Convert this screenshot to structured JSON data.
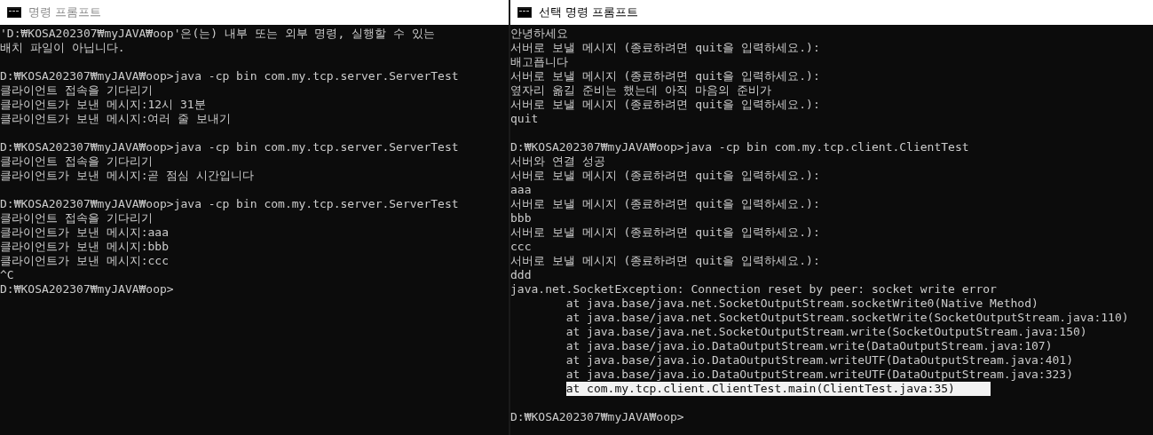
{
  "windows": [
    {
      "title": "명령 프롬프트",
      "active": false,
      "blocks": [
        [
          "'D:₩KOSA202307₩myJAVA₩oop'은(는) 내부 또는 외부 명령, 실행할 수 있는",
          "배치 파일이 아닙니다."
        ],
        [
          "D:₩KOSA202307₩myJAVA₩oop>java -cp bin com.my.tcp.server.ServerTest",
          "클라이언트 접속을 기다리기",
          "클라이언트가 보낸 메시지:12시 31분",
          "클라이언트가 보낸 메시지:여러 줄 보내기"
        ],
        [
          "D:₩KOSA202307₩myJAVA₩oop>java -cp bin com.my.tcp.server.ServerTest",
          "클라이언트 접속을 기다리기",
          "클라이언트가 보낸 메시지:곧 점심 시간입니다"
        ],
        [
          "D:₩KOSA202307₩myJAVA₩oop>java -cp bin com.my.tcp.server.ServerTest",
          "클라이언트 접속을 기다리기",
          "클라이언트가 보낸 메시지:aaa",
          "클라이언트가 보낸 메시지:bbb",
          "클라이언트가 보낸 메시지:ccc",
          "^C",
          "D:₩KOSA202307₩myJAVA₩oop>"
        ]
      ]
    },
    {
      "title": "선택 명령 프롬프트",
      "active": true,
      "blocks": [
        [
          "안녕하세요",
          "서버로 보낼 메시지 (종료하려면 quit을 입력하세요.):",
          "배고픕니다",
          "서버로 보낼 메시지 (종료하려면 quit을 입력하세요.):",
          "옆자리 옮길 준비는 했는데 아직 마음의 준비가",
          "서버로 보낼 메시지 (종료하려면 quit을 입력하세요.):",
          "quit"
        ],
        [
          "D:₩KOSA202307₩myJAVA₩oop>java -cp bin com.my.tcp.client.ClientTest",
          "서버와 연결 성공",
          "서버로 보낼 메시지 (종료하려면 quit을 입력하세요.):",
          "aaa",
          "서버로 보낼 메시지 (종료하려면 quit을 입력하세요.):",
          "bbb",
          "서버로 보낼 메시지 (종료하려면 quit을 입력하세요.):",
          "ccc",
          "서버로 보낼 메시지 (종료하려면 quit을 입력하세요.):",
          "ddd",
          "java.net.SocketException: Connection reset by peer: socket write error",
          "\tat java.base/java.net.SocketOutputStream.socketWrite0(Native Method)",
          "\tat java.base/java.net.SocketOutputStream.socketWrite(SocketOutputStream.java:110)",
          "\tat java.base/java.net.SocketOutputStream.write(SocketOutputStream.java:150)",
          "\tat java.base/java.io.DataOutputStream.write(DataOutputStream.java:107)",
          "\tat java.base/java.io.DataOutputStream.writeUTF(DataOutputStream.java:401)",
          "\tat java.base/java.io.DataOutputStream.writeUTF(DataOutputStream.java:323)",
          {
            "text": "\tat com.my.tcp.client.ClientTest.main(ClientTest.java:35)",
            "selected": true
          }
        ],
        [
          "D:₩KOSA202307₩myJAVA₩oop>"
        ]
      ]
    }
  ]
}
